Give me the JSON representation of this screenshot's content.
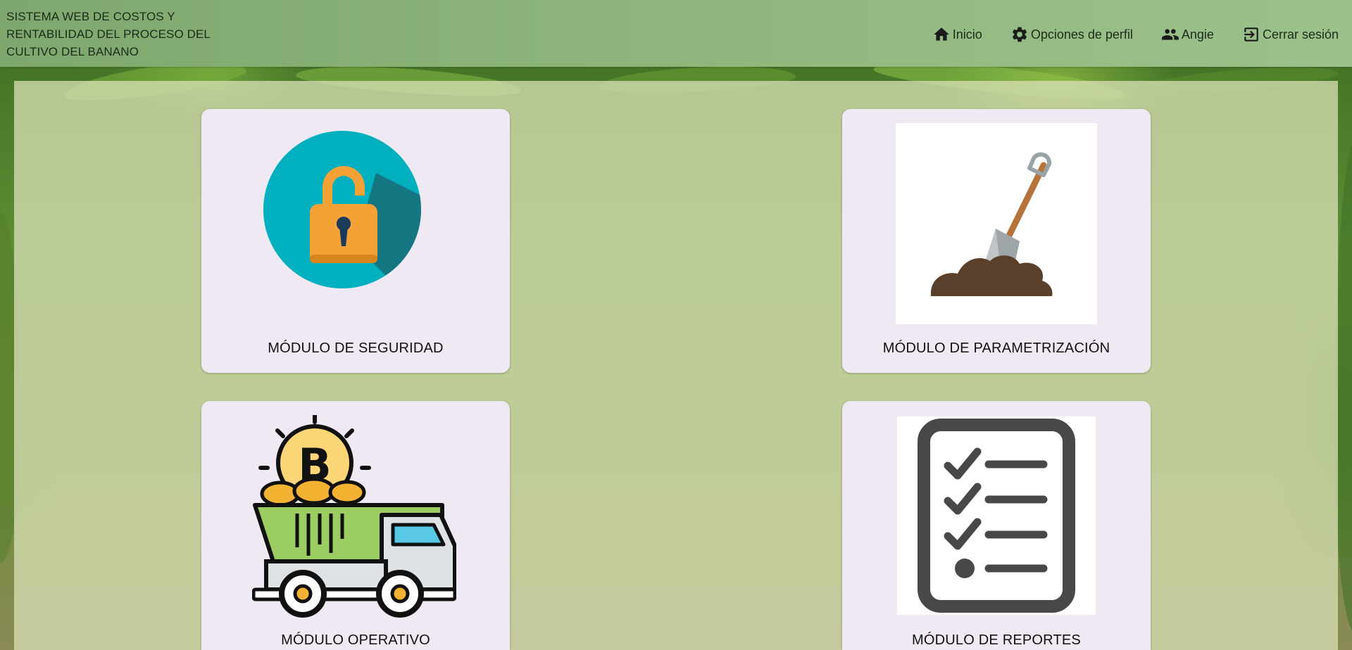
{
  "header": {
    "title": "SISTEMA WEB DE COSTOS Y RENTABILIDAD DEL PROCESO DEL CULTIVO DEL BANANO",
    "nav": [
      {
        "label": "Inicio",
        "icon": "home-icon"
      },
      {
        "label": "Opciones de perfil",
        "icon": "gear-icon"
      },
      {
        "label": "Angie",
        "icon": "users-icon"
      },
      {
        "label": "Cerrar sesión",
        "icon": "logout-icon"
      }
    ]
  },
  "modules": [
    {
      "label": "MÓDULO DE SEGURIDAD",
      "icon": "padlock-icon"
    },
    {
      "label": "MÓDULO DE PARAMETRIZACIÓN",
      "icon": "shovel-icon"
    },
    {
      "label": "MÓDULO OPERATIVO",
      "icon": "dump-truck-bitcoin-icon"
    },
    {
      "label": "MÓDULO DE REPORTES",
      "icon": "checklist-icon"
    }
  ],
  "colors": {
    "header_bg": "#8db57b",
    "card_bg": "#efe9f4",
    "panel_bg": "#d6deb2",
    "teal": "#00b0bf",
    "orange": "#f4a236"
  }
}
